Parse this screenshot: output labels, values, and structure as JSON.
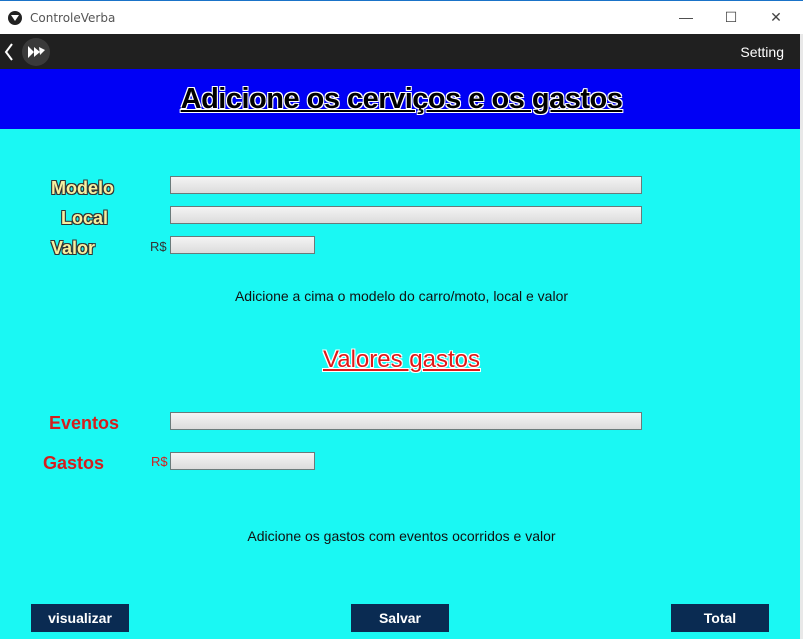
{
  "window": {
    "title": "ControleVerba",
    "minimize_glyph": "—",
    "maximize_glyph": "☐",
    "close_glyph": "✕"
  },
  "actionbar": {
    "setting_label": "Setting",
    "back_icon": "chevron-left",
    "logo_icon": "kivy-logo"
  },
  "header": {
    "title": "Adicione os cerviços e os gastos"
  },
  "form1": {
    "modelo_label": "Modelo",
    "local_label": "Local",
    "valor_label": "Valor",
    "currency": "R$",
    "modelo_value": "",
    "local_value": "",
    "valor_value": "",
    "hint": "Adicione a cima o modelo do carro/moto, local e valor"
  },
  "form2": {
    "section_title": "Valores gastos",
    "eventos_label": "Eventos",
    "gastos_label": "Gastos",
    "currency": "R$",
    "eventos_value": "",
    "gastos_value": "",
    "hint": "Adicione os gastos com eventos ocorridos e valor"
  },
  "buttons": {
    "visualizar": "visualizar",
    "salvar": "Salvar",
    "total": "Total"
  },
  "colors": {
    "header_bg": "#0000f5",
    "content_bg": "#1af8f3",
    "button_bg": "#0a2b52",
    "accent_red": "#d41e1e",
    "label_yellow": "#f6f0a0"
  }
}
